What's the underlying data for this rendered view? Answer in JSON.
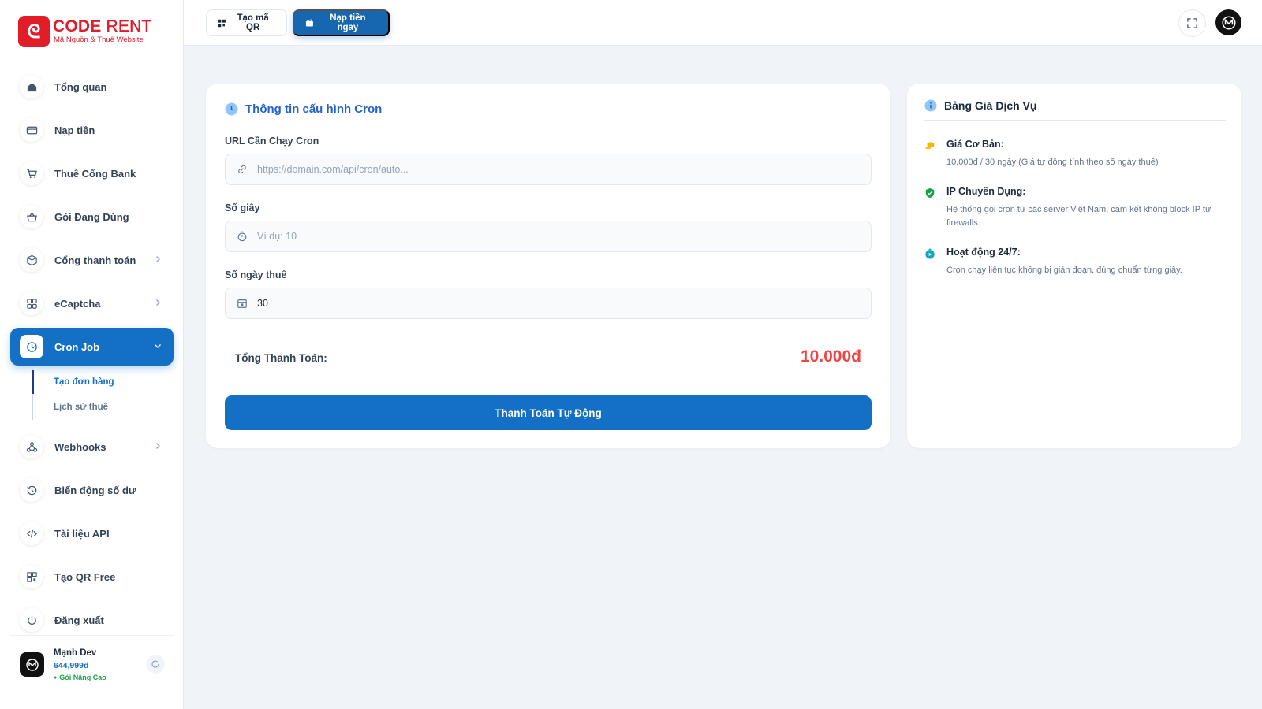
{
  "brand": {
    "name_bold": "CODE",
    "name_light": "RENT",
    "tagline": "Mã Nguồn & Thuê Website"
  },
  "topbar": {
    "qr_label": "Tạo mã QR",
    "topup_label": "Nạp tiền ngay"
  },
  "sidebar": {
    "items": [
      {
        "label": "Tổng quan",
        "icon": "home-icon"
      },
      {
        "label": "Nạp tiền",
        "icon": "card-icon"
      },
      {
        "label": "Thuê Cổng Bank",
        "icon": "cart-icon"
      },
      {
        "label": "Gói Đang Dùng",
        "icon": "basket-icon"
      },
      {
        "label": "Cổng thanh toán",
        "icon": "box-icon"
      },
      {
        "label": "eCaptcha",
        "icon": "grid-icon"
      },
      {
        "label": "Cron Job",
        "icon": "clock-icon"
      },
      {
        "label": "Webhooks",
        "icon": "webhook-icon"
      },
      {
        "label": "Biến động số dư",
        "icon": "history-icon"
      },
      {
        "label": "Tài liệu API",
        "icon": "code-icon"
      },
      {
        "label": "Tạo QR Free",
        "icon": "qr-icon"
      },
      {
        "label": "Đăng xuất",
        "icon": "power-icon"
      }
    ],
    "cron_sub": [
      {
        "label": "Tạo đơn hàng"
      },
      {
        "label": "Lịch sử thuê"
      }
    ]
  },
  "profile": {
    "name": "Mạnh Dev",
    "balance": "644,999đ",
    "plan": "Gói Nâng Cao"
  },
  "form": {
    "title": "Thông tin cấu hình Cron",
    "url_label": "URL Cần Chạy Cron",
    "url_placeholder": "https://domain.com/api/cron/auto...",
    "seconds_label": "Số giây",
    "seconds_placeholder": "Ví dụ: 10",
    "days_label": "Số ngày thuê",
    "days_value": "30",
    "total_label": "Tổng Thanh Toán:",
    "total_value": "10.000đ",
    "pay_label": "Thanh Toán Tự Động"
  },
  "pricing": {
    "title": "Bảng Giá Dịch Vụ",
    "items": [
      {
        "title": "Giá Cơ Bản:",
        "desc": "10,000đ / 30 ngày (Giá tự động tính theo số ngày thuê)",
        "icon": "coins-icon",
        "color": "#f5b800"
      },
      {
        "title": "IP Chuyên Dụng:",
        "desc": "Hệ thống gọi cron từ các server Việt Nam, cam kết không block IP từ firewalls.",
        "icon": "shield-check-icon",
        "color": "#16a34a"
      },
      {
        "title": "Hoạt động 24/7:",
        "desc": "Cron chạy liên tục không bị gián đoạn, đúng chuẩn từng giây.",
        "icon": "stopwatch-icon",
        "color": "#0ea5c6"
      }
    ]
  },
  "colors": {
    "primary": "#1370c5",
    "brand_red": "#e11d2a",
    "total_red": "#ef4444"
  }
}
